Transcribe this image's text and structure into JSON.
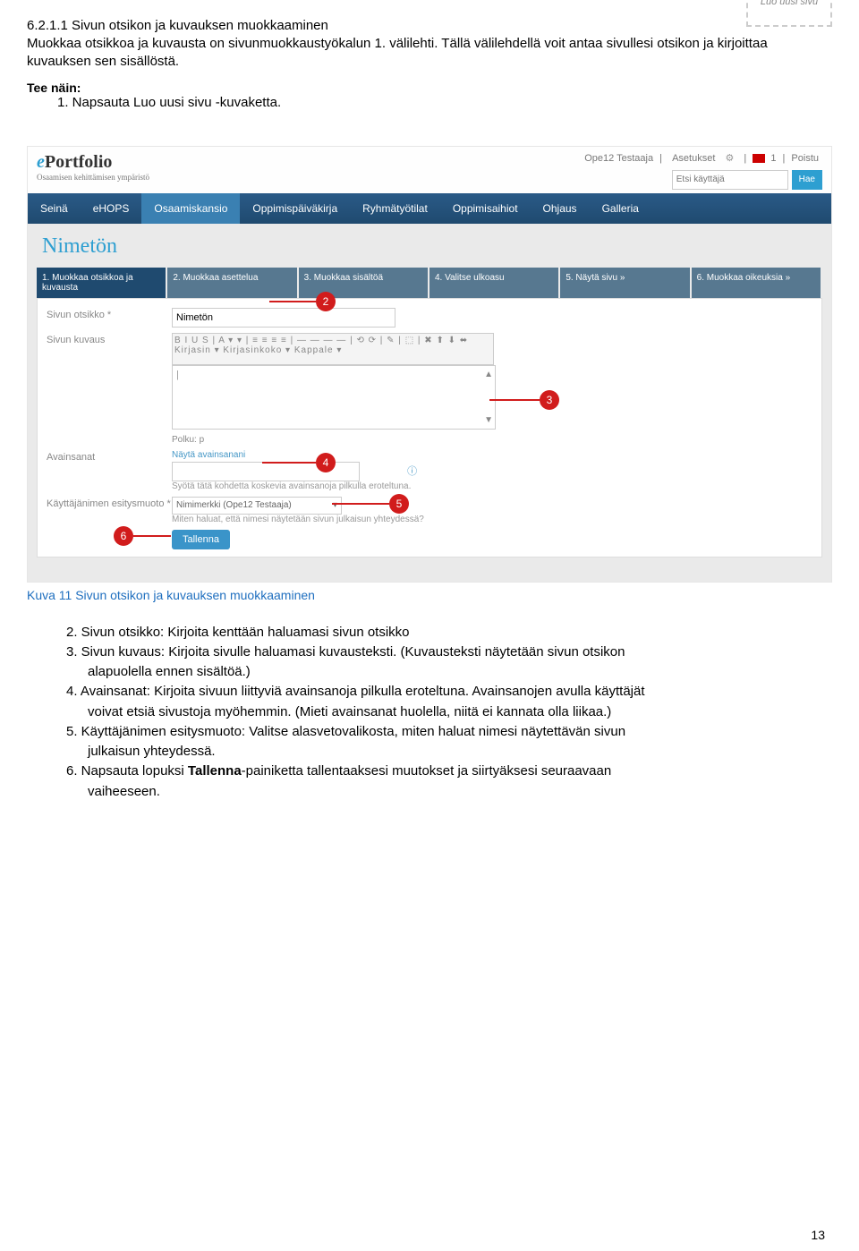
{
  "heading": {
    "num_title": "6.2.1.1   Sivun otsikon ja kuvauksen muokkaaminen"
  },
  "intro": "Muokkaa otsikkoa ja kuvausta on sivunmuokkaustyökalun 1. välilehti. Tällä välilehdellä voit antaa sivullesi otsikon ja kirjoittaa kuvauksen sen sisällöstä.",
  "tee_nain": "Tee näin:",
  "step1": "1. Napsauta Luo uusi sivu -kuvaketta.",
  "luo_uusi": {
    "label": "Luo uusi sivu"
  },
  "header_links": {
    "user": "Ope12 Testaaja",
    "settings": "Asetukset",
    "count": "1",
    "logout": "Poistu",
    "search_placeholder": "Etsi käyttäjä",
    "search_btn": "Hae"
  },
  "logo": {
    "p1": "e",
    "p2": "Portfolio",
    "sub": "Osaamisen kehittämisen ympäristö"
  },
  "nav": {
    "items": [
      "Seinä",
      "eHOPS",
      "Osaamiskansio",
      "Oppimispäiväkirja",
      "Ryhmätyötilat",
      "Oppimisaihiot",
      "Ohjaus",
      "Galleria"
    ],
    "active_index": 2
  },
  "page_title": "Nimetön",
  "wizard": {
    "items": [
      "1. Muokkaa otsikkoa ja kuvausta",
      "2. Muokkaa asettelua",
      "3. Muokkaa sisältöä",
      "4. Valitse ulkoasu",
      "5. Näytä sivu »",
      "6. Muokkaa oikeuksia »"
    ]
  },
  "form": {
    "otsikko_label": "Sivun otsikko *",
    "otsikko_value": "Nimetön",
    "kuvaus_label": "Sivun kuvaus",
    "toolbar": "B  I  U  S  |  A ▾ ▾ |  ≡ ≡ ≡ ≡  |  —  —  —  —  | ⟲  ⟳  |  ✎  |  ⬚  |  ✖  ⬆  ⬇  ⬌",
    "toolbar2": "Kirjasin     ▾   Kirjasinkoko ▾   Kappale   ▾",
    "path": "Polku: p",
    "avainsanat_label": "Avainsanat",
    "avainsanat_link": "Näytä avainsanani",
    "avainsanat_hint": "Syötä tätä kohdetta koskevia avainsanoja pilkulla eroteltuna.",
    "esitysmuoto_label": "Käyttäjänimen esitysmuoto *",
    "esitysmuoto_value": "Nimimerkki (Ope12 Testaaja)",
    "esitysmuoto_hint": "Miten haluat, että nimesi näytetään sivun julkaisun yhteydessä?",
    "tallenna": "Tallenna"
  },
  "annotations": {
    "a2": "2",
    "a3": "3",
    "a4": "4",
    "a5": "5",
    "a6": "6"
  },
  "caption": "Kuva 11 Sivun otsikon ja kuvauksen muokkaaminen",
  "list": {
    "i2": "2. Sivun otsikko: Kirjoita kenttään haluamasi sivun otsikko",
    "i3a": "3. Sivun kuvaus: Kirjoita sivulle haluamasi kuvausteksti. (Kuvausteksti näytetään sivun otsikon",
    "i3b": "alapuolella ennen sisältöä.)",
    "i4a": "4. Avainsanat: Kirjoita sivuun liittyviä avainsanoja pilkulla eroteltuna. Avainsanojen avulla käyttäjät",
    "i4b": "voivat etsiä sivustoja myöhemmin. (Mieti avainsanat huolella, niitä ei kannata olla liikaa.)",
    "i5a": "5. Käyttäjänimen esitysmuoto: Valitse alasvetovalikosta, miten haluat nimesi näytettävän sivun",
    "i5b": "julkaisun yhteydessä.",
    "i6a_prefix": "6. Napsauta lopuksi ",
    "i6a_bold": "Tallenna",
    "i6a_suffix": "-painiketta tallentaaksesi muutokset ja siirtyäksesi seuraavaan",
    "i6b": "vaiheeseen."
  },
  "page_number": "13"
}
